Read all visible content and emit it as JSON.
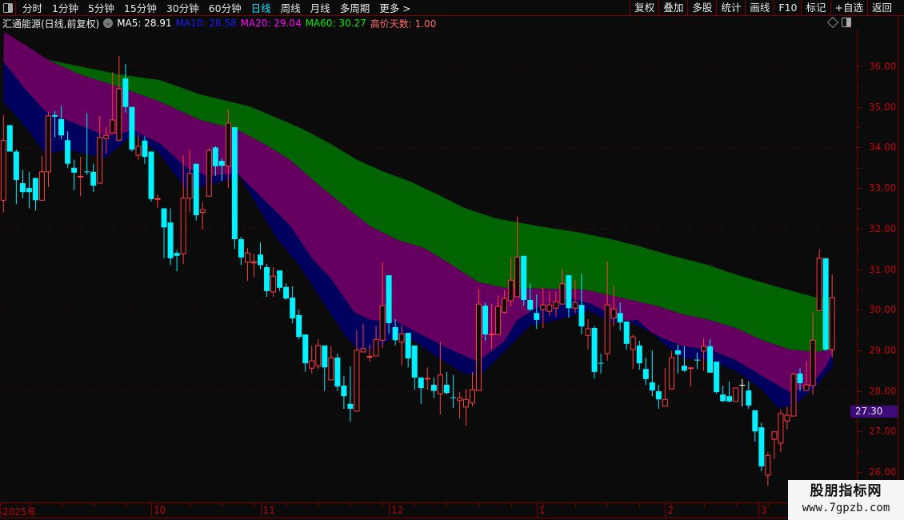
{
  "toolbar": {
    "periods": [
      "分时",
      "1分钟",
      "5分钟",
      "15分钟",
      "30分钟",
      "60分钟",
      "日线",
      "周线",
      "月线",
      "多周期",
      "更多 >"
    ],
    "active_period": "日线",
    "buttons": [
      "复权",
      "叠加",
      "多股",
      "统计",
      "画线",
      "F10",
      "标记",
      "+自选",
      "返回"
    ]
  },
  "info": {
    "title": "汇通能源(日线,前复权)",
    "ma5": "MA5: 28.91",
    "ma10": "MA10: 28.58",
    "ma20": "MA20: 29.04",
    "ma60": "MA60: 30.27",
    "high_days": "高价天数: 1.00"
  },
  "colors": {
    "up": "#ff3c3c",
    "down": "#00f0ff",
    "flat": "#ffffff",
    "ma5": "#ffffff",
    "ma10": "#1a1aff",
    "ma20": "#ff00ff",
    "ma60": "#00ee00",
    "high_days": "#ff6a6a",
    "band_green": "#006400",
    "band_purple": "#650060",
    "band_navy": "#00005e",
    "axis": "#c00000",
    "grid": "#7a0000"
  },
  "price_tag": "27.30",
  "x_axis": {
    "labels": [
      {
        "text": "2025年",
        "index": 0
      },
      {
        "text": "10",
        "index": 23
      },
      {
        "text": "11",
        "index": 40
      },
      {
        "text": "12",
        "index": 60
      },
      {
        "text": "1",
        "index": 83
      },
      {
        "text": "2",
        "index": 103
      },
      {
        "text": "3",
        "index": 117.5
      }
    ]
  },
  "watermark": {
    "title": "股朋指标网",
    "url": "www.7gpzb.com"
  },
  "chart_data": {
    "type": "candlestick",
    "ylim": [
      25.5,
      36.9
    ],
    "y_ticks": [
      "36.00",
      "35.00",
      "34.00",
      "33.00",
      "32.00",
      "31.00",
      "30.00",
      "29.00",
      "28.00",
      "27.00",
      "26.00"
    ],
    "grid_dotted_at": [
      36,
      34,
      32,
      30,
      28,
      26
    ],
    "candles_ohlc": [
      [
        32.7,
        34.8,
        32.4,
        34.17
      ],
      [
        34.55,
        34.55,
        33.9,
        33.9
      ],
      [
        33.9,
        33.95,
        32.6,
        33.2
      ],
      [
        33.12,
        33.45,
        32.75,
        32.9
      ],
      [
        33.0,
        33.4,
        32.5,
        32.9
      ],
      [
        33.25,
        33.25,
        32.45,
        32.7
      ],
      [
        32.7,
        33.8,
        32.7,
        33.4
      ],
      [
        33.4,
        34.88,
        33.02,
        34.78
      ],
      [
        34.8,
        34.9,
        34.25,
        34.76
      ],
      [
        34.7,
        35.03,
        34.2,
        34.3
      ],
      [
        34.18,
        34.4,
        33.5,
        33.6
      ],
      [
        33.5,
        33.7,
        32.95,
        33.38
      ],
      [
        33.27,
        33.77,
        32.8,
        33.29
      ],
      [
        33.41,
        34.85,
        33.33,
        33.39
      ],
      [
        33.4,
        33.6,
        32.9,
        33.06
      ],
      [
        33.12,
        34.78,
        33.12,
        34.25
      ],
      [
        34.22,
        34.5,
        33.85,
        34.3
      ],
      [
        34.36,
        35.86,
        34.36,
        34.68
      ],
      [
        34.18,
        36.26,
        34.18,
        35.45
      ],
      [
        35.7,
        36.06,
        34.86,
        35.0
      ],
      [
        35.0,
        35.0,
        33.9,
        33.95
      ],
      [
        33.81,
        34.32,
        33.7,
        34.03
      ],
      [
        34.17,
        34.28,
        33.6,
        33.77
      ],
      [
        33.9,
        33.9,
        32.67,
        32.73
      ],
      [
        32.72,
        32.84,
        32.5,
        32.74
      ],
      [
        32.5,
        32.5,
        31.27,
        32.03
      ],
      [
        32.15,
        32.5,
        31.1,
        31.27
      ],
      [
        31.4,
        31.46,
        30.95,
        31.33
      ],
      [
        31.38,
        33.8,
        31.13,
        32.75
      ],
      [
        32.75,
        33.93,
        32.4,
        33.36
      ],
      [
        33.6,
        33.6,
        32.2,
        32.33
      ],
      [
        32.4,
        32.65,
        31.98,
        32.47
      ],
      [
        32.8,
        33.97,
        32.8,
        33.93
      ],
      [
        34.0,
        34.03,
        33.3,
        33.54
      ],
      [
        33.67,
        33.73,
        33.18,
        33.55
      ],
      [
        33.54,
        34.93,
        33.0,
        34.6
      ],
      [
        34.5,
        34.5,
        31.5,
        31.74
      ],
      [
        31.74,
        31.8,
        31.1,
        31.29
      ],
      [
        31.17,
        31.52,
        30.71,
        31.4
      ],
      [
        31.16,
        31.38,
        30.81,
        31.18
      ],
      [
        31.36,
        31.66,
        31.0,
        31.1
      ],
      [
        31.05,
        31.13,
        30.32,
        30.46
      ],
      [
        30.44,
        31.05,
        30.32,
        30.83
      ],
      [
        30.97,
        30.97,
        30.46,
        30.54
      ],
      [
        30.56,
        30.65,
        30.24,
        30.28
      ],
      [
        30.3,
        30.58,
        29.67,
        29.79
      ],
      [
        29.87,
        30.0,
        29.27,
        29.33
      ],
      [
        29.39,
        29.39,
        28.47,
        28.68
      ],
      [
        28.56,
        29.12,
        28.43,
        28.74
      ],
      [
        28.62,
        29.27,
        28.54,
        29.12
      ],
      [
        29.12,
        29.12,
        28.0,
        28.58
      ],
      [
        28.27,
        29.1,
        28.27,
        28.82
      ],
      [
        28.82,
        28.92,
        28.0,
        28.11
      ],
      [
        28.13,
        28.37,
        27.56,
        27.87
      ],
      [
        27.68,
        28.6,
        27.24,
        27.56
      ],
      [
        27.5,
        29.49,
        27.5,
        29.0
      ],
      [
        28.96,
        29.65,
        28.96,
        29.04
      ],
      [
        28.83,
        29.14,
        28.72,
        28.85
      ],
      [
        28.86,
        29.6,
        28.86,
        29.27
      ],
      [
        29.25,
        31.17,
        29.06,
        30.1
      ],
      [
        30.85,
        30.85,
        29.41,
        29.67
      ],
      [
        29.57,
        29.77,
        29.12,
        29.25
      ],
      [
        29.2,
        29.63,
        28.62,
        29.41
      ],
      [
        29.43,
        29.43,
        28.58,
        28.8
      ],
      [
        29.12,
        29.12,
        28.03,
        28.33
      ],
      [
        28.33,
        28.33,
        27.68,
        28.07
      ],
      [
        28.29,
        28.58,
        28.03,
        28.31
      ],
      [
        28.15,
        28.33,
        27.82,
        28.0
      ],
      [
        27.93,
        29.2,
        27.42,
        28.39
      ],
      [
        28.15,
        28.47,
        27.91,
        27.95
      ],
      [
        27.84,
        28.39,
        27.58,
        27.82
      ],
      [
        27.77,
        27.97,
        27.32,
        27.83
      ],
      [
        27.6,
        28.05,
        27.14,
        27.79
      ],
      [
        27.7,
        28.47,
        27.62,
        28.03
      ],
      [
        28.01,
        30.52,
        28.01,
        30.14
      ],
      [
        30.1,
        30.18,
        29.24,
        29.39
      ],
      [
        29.38,
        30.14,
        29.04,
        29.4
      ],
      [
        29.39,
        30.36,
        29.39,
        30.08
      ],
      [
        29.94,
        30.48,
        29.9,
        30.28
      ],
      [
        30.22,
        31.29,
        30.08,
        30.73
      ],
      [
        30.32,
        32.3,
        30.32,
        31.3
      ],
      [
        31.33,
        31.33,
        30.1,
        30.24
      ],
      [
        30.24,
        30.65,
        29.98,
        30.0
      ],
      [
        29.92,
        30.38,
        29.53,
        29.75
      ],
      [
        30.0,
        30.54,
        29.55,
        30.12
      ],
      [
        29.96,
        30.46,
        29.85,
        30.12
      ],
      [
        30.04,
        30.44,
        29.83,
        30.2
      ],
      [
        30.14,
        31.0,
        30.14,
        30.64
      ],
      [
        30.85,
        30.85,
        29.81,
        30.04
      ],
      [
        30.04,
        30.73,
        29.92,
        30.18
      ],
      [
        30.12,
        30.89,
        29.39,
        29.59
      ],
      [
        29.37,
        29.77,
        29.02,
        29.53
      ],
      [
        29.55,
        29.6,
        28.3,
        28.47
      ],
      [
        28.69,
        28.92,
        28.43,
        28.67
      ],
      [
        28.92,
        31.19,
        28.74,
        30.12
      ],
      [
        29.79,
        30.6,
        29.59,
        30.02
      ],
      [
        29.92,
        30.18,
        29.49,
        29.69
      ],
      [
        29.71,
        29.71,
        29.02,
        29.16
      ],
      [
        29.02,
        29.39,
        28.54,
        29.33
      ],
      [
        29.12,
        29.24,
        28.52,
        28.68
      ],
      [
        28.54,
        28.82,
        28.15,
        28.29
      ],
      [
        28.21,
        29.0,
        27.87,
        28.01
      ],
      [
        27.99,
        28.15,
        27.56,
        27.79
      ],
      [
        27.62,
        28.56,
        27.62,
        27.79
      ],
      [
        28.05,
        28.98,
        28.05,
        28.82
      ],
      [
        29.0,
        29.14,
        28.43,
        28.9
      ],
      [
        28.62,
        29.1,
        28.47,
        28.5
      ],
      [
        28.55,
        28.57,
        28.11,
        28.57
      ],
      [
        28.77,
        28.94,
        28.54,
        28.75
      ],
      [
        28.98,
        29.3,
        28.5,
        29.1
      ],
      [
        29.1,
        29.27,
        28.45,
        28.45
      ],
      [
        28.72,
        28.72,
        27.93,
        27.97
      ],
      [
        27.91,
        28.13,
        27.72,
        27.75
      ],
      [
        27.87,
        28.23,
        27.72,
        27.74
      ],
      [
        27.74,
        28.07,
        27.74,
        28.07
      ],
      [
        28.15,
        28.29,
        27.62,
        28.15
      ],
      [
        28.01,
        28.23,
        27.56,
        27.64
      ],
      [
        27.52,
        27.52,
        26.75,
        27.0
      ],
      [
        27.1,
        27.22,
        26.02,
        26.14
      ],
      [
        25.92,
        26.49,
        25.66,
        26.41
      ],
      [
        26.81,
        26.99,
        26.32,
        26.99
      ],
      [
        26.71,
        27.54,
        26.49,
        27.44
      ],
      [
        27.26,
        27.6,
        27.05,
        27.4
      ],
      [
        27.38,
        28.45,
        27.38,
        28.41
      ],
      [
        28.43,
        28.56,
        28.0,
        28.19
      ],
      [
        28.01,
        28.74,
        28.01,
        28.15
      ],
      [
        28.13,
        29.94,
        27.91,
        29.25
      ],
      [
        29.98,
        31.5,
        29.98,
        31.27
      ],
      [
        31.27,
        31.27,
        28.98,
        29.02
      ],
      [
        29.02,
        30.87,
        28.82,
        30.3
      ]
    ],
    "bands": {
      "line_a": [
        [
          0.1,
          36.85
        ],
        [
          3.2,
          36.55
        ],
        [
          6.9,
          36.16
        ],
        [
          11.9,
          36.0
        ],
        [
          18.1,
          35.8
        ],
        [
          24.4,
          35.66
        ],
        [
          30.6,
          35.31
        ],
        [
          34.3,
          35.17
        ],
        [
          38.4,
          35.01
        ],
        [
          42.7,
          34.72
        ],
        [
          46.8,
          34.44
        ],
        [
          50.9,
          34.09
        ],
        [
          55.1,
          33.69
        ],
        [
          59.2,
          33.4
        ],
        [
          63.3,
          33.16
        ],
        [
          67.6,
          32.84
        ],
        [
          71.7,
          32.51
        ],
        [
          76.7,
          32.25
        ],
        [
          84.1,
          32.04
        ],
        [
          89.1,
          31.92
        ],
        [
          94.1,
          31.76
        ],
        [
          99.1,
          31.56
        ],
        [
          104.1,
          31.33
        ],
        [
          109.1,
          31.13
        ],
        [
          114.0,
          30.87
        ],
        [
          119.0,
          30.63
        ],
        [
          124.0,
          30.41
        ],
        [
          126.5,
          30.3
        ],
        [
          129.1,
          30.3
        ]
      ],
      "line_b": [
        [
          0.1,
          36.85
        ],
        [
          3.2,
          36.55
        ],
        [
          6.9,
          36.16
        ],
        [
          11.9,
          35.8
        ],
        [
          18.1,
          35.49
        ],
        [
          24.4,
          35.13
        ],
        [
          30.6,
          34.68
        ],
        [
          36.4,
          34.44
        ],
        [
          40.6,
          34.09
        ],
        [
          44.7,
          33.69
        ],
        [
          48.9,
          33.1
        ],
        [
          53.0,
          32.57
        ],
        [
          57.1,
          32.06
        ],
        [
          61.4,
          31.72
        ],
        [
          65.5,
          31.52
        ],
        [
          69.6,
          31.13
        ],
        [
          73.8,
          30.69
        ],
        [
          77.9,
          30.54
        ],
        [
          84.1,
          30.52
        ],
        [
          90.4,
          30.5
        ],
        [
          96.6,
          30.28
        ],
        [
          101.6,
          30.1
        ],
        [
          105.7,
          29.89
        ],
        [
          109.9,
          29.75
        ],
        [
          114.0,
          29.55
        ],
        [
          118.1,
          29.25
        ],
        [
          122.4,
          29.02
        ],
        [
          126.5,
          28.96
        ],
        [
          129.1,
          29.02
        ]
      ],
      "line_c": [
        [
          0,
          36.12
        ],
        [
          3.2,
          35.47
        ],
        [
          6.6,
          34.88
        ],
        [
          9.8,
          34.68
        ],
        [
          16.0,
          34.28
        ],
        [
          20.3,
          34.42
        ],
        [
          24.4,
          34.09
        ],
        [
          28.5,
          33.5
        ],
        [
          31.8,
          33.3
        ],
        [
          36.4,
          33.36
        ],
        [
          40.6,
          32.71
        ],
        [
          44.7,
          32.06
        ],
        [
          48.0,
          31.27
        ],
        [
          50.9,
          30.79
        ],
        [
          54.6,
          29.94
        ],
        [
          57.1,
          29.75
        ],
        [
          61.4,
          29.69
        ],
        [
          65.5,
          29.35
        ],
        [
          69.6,
          29.02
        ],
        [
          73.3,
          28.76
        ],
        [
          74.2,
          28.76
        ],
        [
          77.9,
          29.21
        ],
        [
          80.0,
          29.75
        ],
        [
          83.3,
          30.08
        ],
        [
          88.3,
          30.28
        ],
        [
          91.6,
          30.14
        ],
        [
          94.5,
          29.89
        ],
        [
          98.7,
          29.61
        ],
        [
          102.8,
          29.29
        ],
        [
          105.7,
          29.1
        ],
        [
          109.9,
          29.02
        ],
        [
          114.0,
          28.76
        ],
        [
          118.1,
          28.37
        ],
        [
          122.4,
          27.97
        ],
        [
          125.6,
          28.11
        ],
        [
          128.1,
          28.62
        ],
        [
          129.1,
          28.96
        ]
      ],
      "line_d": [
        [
          0,
          35.13
        ],
        [
          3.6,
          34.48
        ],
        [
          6.6,
          33.83
        ],
        [
          9.8,
          33.95
        ],
        [
          13.2,
          33.83
        ],
        [
          16.0,
          33.75
        ],
        [
          20.3,
          34.34
        ],
        [
          24.4,
          33.83
        ],
        [
          28.5,
          32.96
        ],
        [
          32.7,
          33.1
        ],
        [
          36.8,
          33.3
        ],
        [
          39.7,
          32.51
        ],
        [
          42.7,
          31.72
        ],
        [
          45.9,
          31.13
        ],
        [
          48.9,
          30.4
        ],
        [
          53.0,
          29.41
        ],
        [
          55.1,
          29.02
        ],
        [
          57.6,
          29.02
        ],
        [
          60.5,
          29.29
        ],
        [
          63.4,
          29.29
        ],
        [
          67.6,
          28.82
        ],
        [
          71.7,
          28.43
        ],
        [
          74.2,
          28.37
        ],
        [
          77.9,
          28.96
        ],
        [
          82.0,
          29.61
        ],
        [
          86.3,
          29.75
        ],
        [
          91.2,
          29.98
        ],
        [
          94.5,
          29.69
        ],
        [
          98.7,
          29.75
        ],
        [
          102.8,
          29.16
        ],
        [
          105.7,
          28.8
        ],
        [
          109.9,
          28.76
        ],
        [
          114.0,
          28.5
        ],
        [
          118.1,
          28.03
        ],
        [
          120.6,
          27.58
        ],
        [
          123.1,
          27.64
        ],
        [
          126.5,
          28.11
        ],
        [
          129.1,
          28.62
        ]
      ]
    }
  }
}
